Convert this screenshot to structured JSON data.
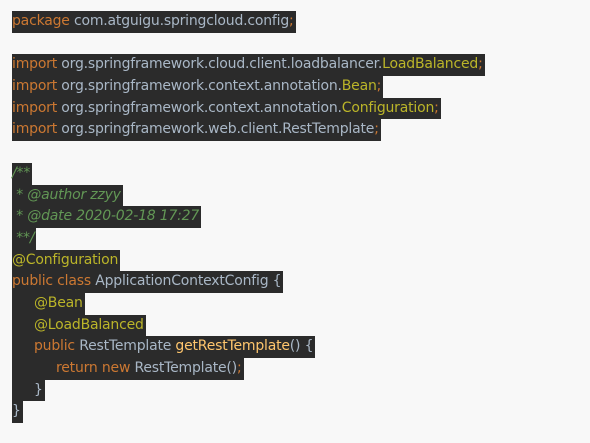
{
  "code": {
    "package_kw": "package",
    "package_name": " com.atguigu.springcloud.config",
    "semi": ";",
    "imports": [
      {
        "kw": "import",
        "path": " org.springframework.cloud.client.loadbalancer.",
        "cls": "LoadBalanced"
      },
      {
        "kw": "import",
        "path": " org.springframework.context.annotation.",
        "cls": "Bean"
      },
      {
        "kw": "import",
        "path": " org.springframework.context.annotation.",
        "cls": "Configuration"
      },
      {
        "kw": "import",
        "path": " org.springframework.web.client.RestTemplate",
        "cls": ""
      }
    ],
    "doc": {
      "open": "/**",
      "author": " * @author zzyy",
      "date": " * @date 2020-02-18 17:27",
      "close": " **/"
    },
    "class_annotation": "@Configuration",
    "class_decl": {
      "kw": "public class",
      "name": " ApplicationContextConfig ",
      "brace": "{"
    },
    "method": {
      "annotation1": "@Bean",
      "annotation2": "@LoadBalanced",
      "kw": "public",
      "type": " RestTemplate ",
      "name": "getRestTemplate",
      "sig_rest": "() {"
    },
    "body": {
      "kw1": "return",
      "kw2": " new",
      "expr": " RestTemplate()"
    },
    "close_method": "}",
    "close_class": "}"
  }
}
